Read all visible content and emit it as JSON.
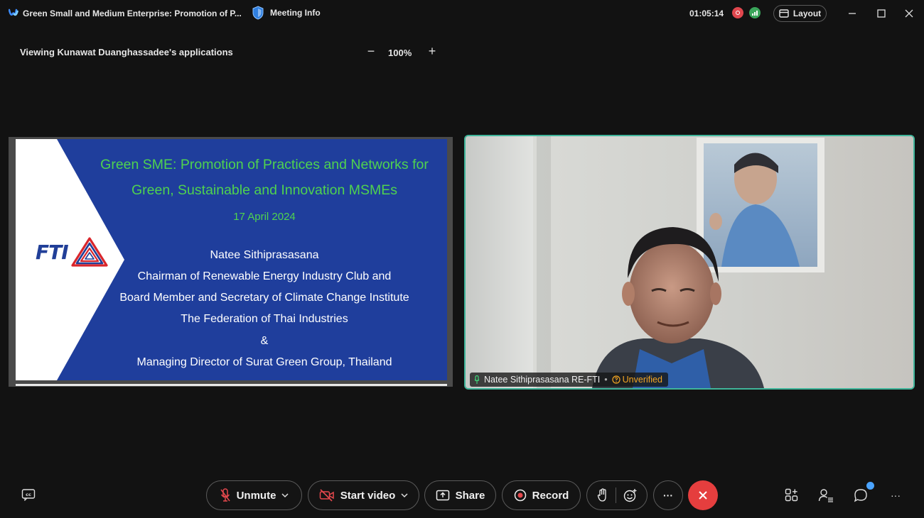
{
  "window": {
    "meeting_title": "Green Small and Medium Enterprise: Promotion of P...",
    "meeting_info_label": "Meeting Info",
    "timer": "01:05:14",
    "layout_label": "Layout",
    "icons": [
      "webex-logo",
      "shield-icon",
      "record-indicator-icon",
      "network-icon",
      "layout-icon",
      "minimize-icon",
      "maximize-icon",
      "close-icon"
    ]
  },
  "share": {
    "viewing_label": "Viewing Kunawat Duanghassadee's applications",
    "zoom_level": "100%",
    "zoom_out_label": "−",
    "zoom_in_label": "+"
  },
  "slide": {
    "logo_text": "FTI",
    "title_line1": "Green SME: Promotion of Practices and Networks for",
    "title_line2": "Green, Sustainable and Innovation MSMEs",
    "date": "17 April 2024",
    "lines": [
      "Natee Sithiprasasana",
      "Chairman of Renewable Energy Industry Club and",
      "Board Member and Secretary of Climate Change Institute",
      "The Federation of Thai Industries",
      "&",
      "Managing Director of Surat Green Group, Thailand"
    ],
    "colors": {
      "background": "#1f3e9c",
      "title": "#4fd24f",
      "text": "#ffffff"
    }
  },
  "participant": {
    "name": "Natee Sithiprasasana RE-FTI",
    "status": "Unverified",
    "colors": {
      "active_border": "#3fb59a",
      "status": "#f5a623"
    }
  },
  "controls": {
    "unmute_label": "Unmute",
    "start_video_label": "Start video",
    "share_label": "Share",
    "record_label": "Record",
    "more_label": "···",
    "end_color": "#e53e3e",
    "icons": [
      "captions-icon",
      "mic-muted-icon",
      "video-off-icon",
      "share-screen-icon",
      "record-icon",
      "raise-hand-icon",
      "reactions-icon",
      "more-icon",
      "end-call-icon",
      "apps-icon",
      "participants-icon",
      "chat-icon",
      "more-options-icon"
    ]
  }
}
